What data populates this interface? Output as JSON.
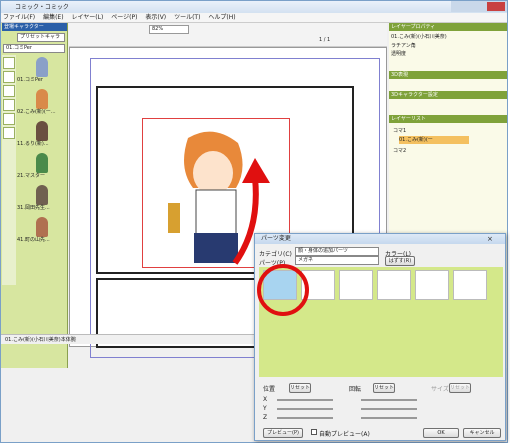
{
  "app": {
    "title": "コミック・コミック",
    "menu": [
      "ファイル(F)",
      "編集(E)",
      "レイヤー(L)",
      "ページ(P)",
      "表示(V)",
      "ツール(T)",
      "ヘルプ(H)"
    ]
  },
  "toolbar": {
    "zoom": "82%",
    "page": "1 / 1"
  },
  "left": {
    "header": "登場キャラクター",
    "preset": "プリセットキャラ",
    "char_select": "01.コミPer",
    "chars": [
      "01.コミPer",
      "02.こみ(新)(ー...",
      "11.るり(新)...",
      "21.マスター",
      "31.岡田先生...",
      "41.町の山先..."
    ]
  },
  "canvas": {
    "status": "01.こみ(新)(小石川美奈)本体腕"
  },
  "right": {
    "props_header": "レイヤープロパティ",
    "layer_name": "01.こみ(新)(小石川美奈)",
    "field1": "ラチアン角",
    "field2": "透明度",
    "sec3d": "3D表現",
    "sec_char": "3Dキャラクター設定",
    "layers_header": "レイヤーリスト",
    "layers": [
      "コマ1",
      "01.こみ(新)(ー",
      "コマ2"
    ]
  },
  "dialog": {
    "title": "パーツ変更",
    "category_label": "カテゴリ(C)",
    "category_value": "顔・身体の追加パーツ",
    "color_label": "カラー(L)",
    "part_label": "パーツ(P)",
    "part_value": "メガネ",
    "remove": "はずす(R)",
    "pos": "位置",
    "rot": "回転",
    "size": "サイズ",
    "reset": "リセット",
    "x": "X",
    "y": "Y",
    "z": "Z",
    "preview": "プレビュー(P)",
    "auto": "自動プレビュー(A)",
    "ok": "OK",
    "cancel": "キャンセル"
  },
  "colors": {
    "accent": "#e01010",
    "green": "#d4e88a"
  }
}
